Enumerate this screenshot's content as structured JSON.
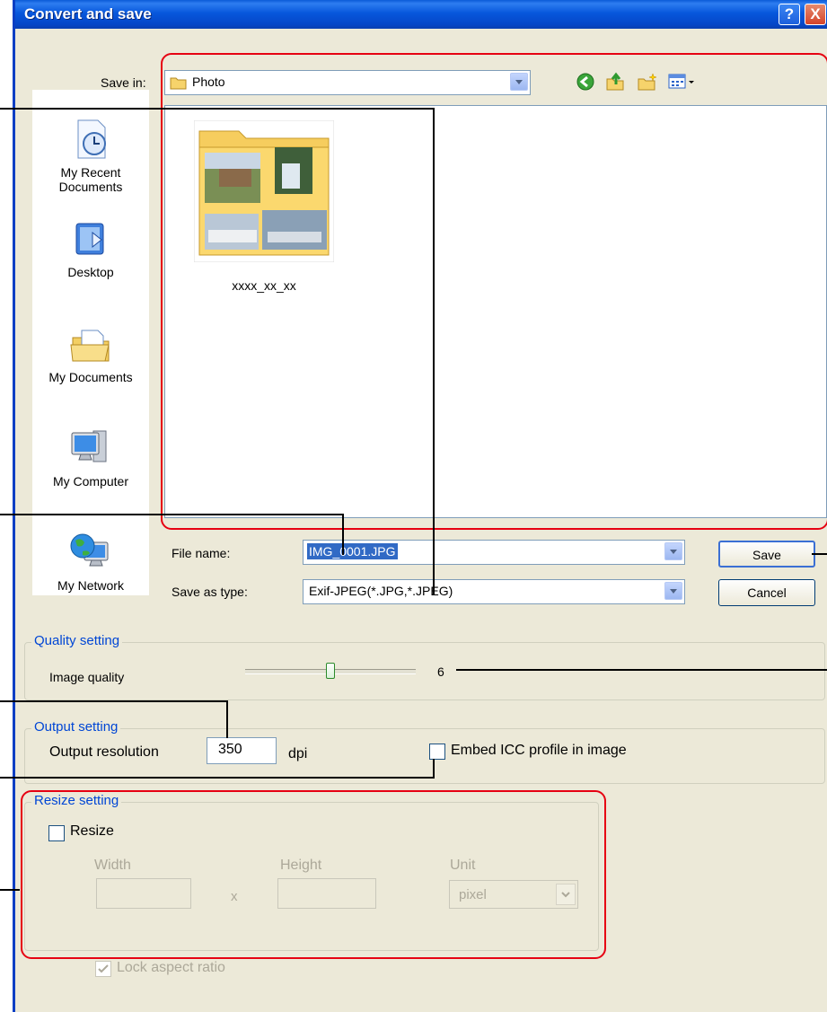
{
  "window": {
    "title": "Convert and save",
    "help_label": "?",
    "close_label": "X"
  },
  "save_in": {
    "label": "Save in:",
    "value": "Photo"
  },
  "places": [
    {
      "label_line1": "My Recent",
      "label_line2": "Documents"
    },
    {
      "label_line1": "Desktop"
    },
    {
      "label_line1": "My Documents"
    },
    {
      "label_line1": "My Computer"
    },
    {
      "label_line1": "My Network"
    }
  ],
  "file_list": {
    "items": [
      {
        "name": "xxxx_xx_xx"
      }
    ]
  },
  "file_name": {
    "label": "File name:",
    "value": "IMG_0001.JPG"
  },
  "save_as_type": {
    "label": "Save as type:",
    "value": "Exif-JPEG(*.JPG,*.JPEG)"
  },
  "buttons": {
    "save": "Save",
    "cancel": "Cancel"
  },
  "quality": {
    "group_title": "Quality setting",
    "label": "Image quality",
    "value": "6",
    "slider_fraction": 0.5
  },
  "output": {
    "group_title": "Output setting",
    "resolution_label": "Output resolution",
    "resolution_value": "350",
    "unit": "dpi",
    "embed_icc_label": "Embed ICC profile in image",
    "embed_icc_checked": false
  },
  "resize": {
    "group_title": "Resize setting",
    "resize_label": "Resize",
    "resize_checked": false,
    "width_label": "Width",
    "height_label": "Height",
    "times": "x",
    "unit_label": "Unit",
    "unit_value": "pixel",
    "lock_label": "Lock aspect ratio",
    "lock_checked": true
  },
  "colors": {
    "title_bar": "#0a5bd8",
    "dialog_bg": "#ece9d8",
    "group_title": "#0046d5",
    "highlight_border": "#e60012",
    "selection": "#316ac5"
  }
}
